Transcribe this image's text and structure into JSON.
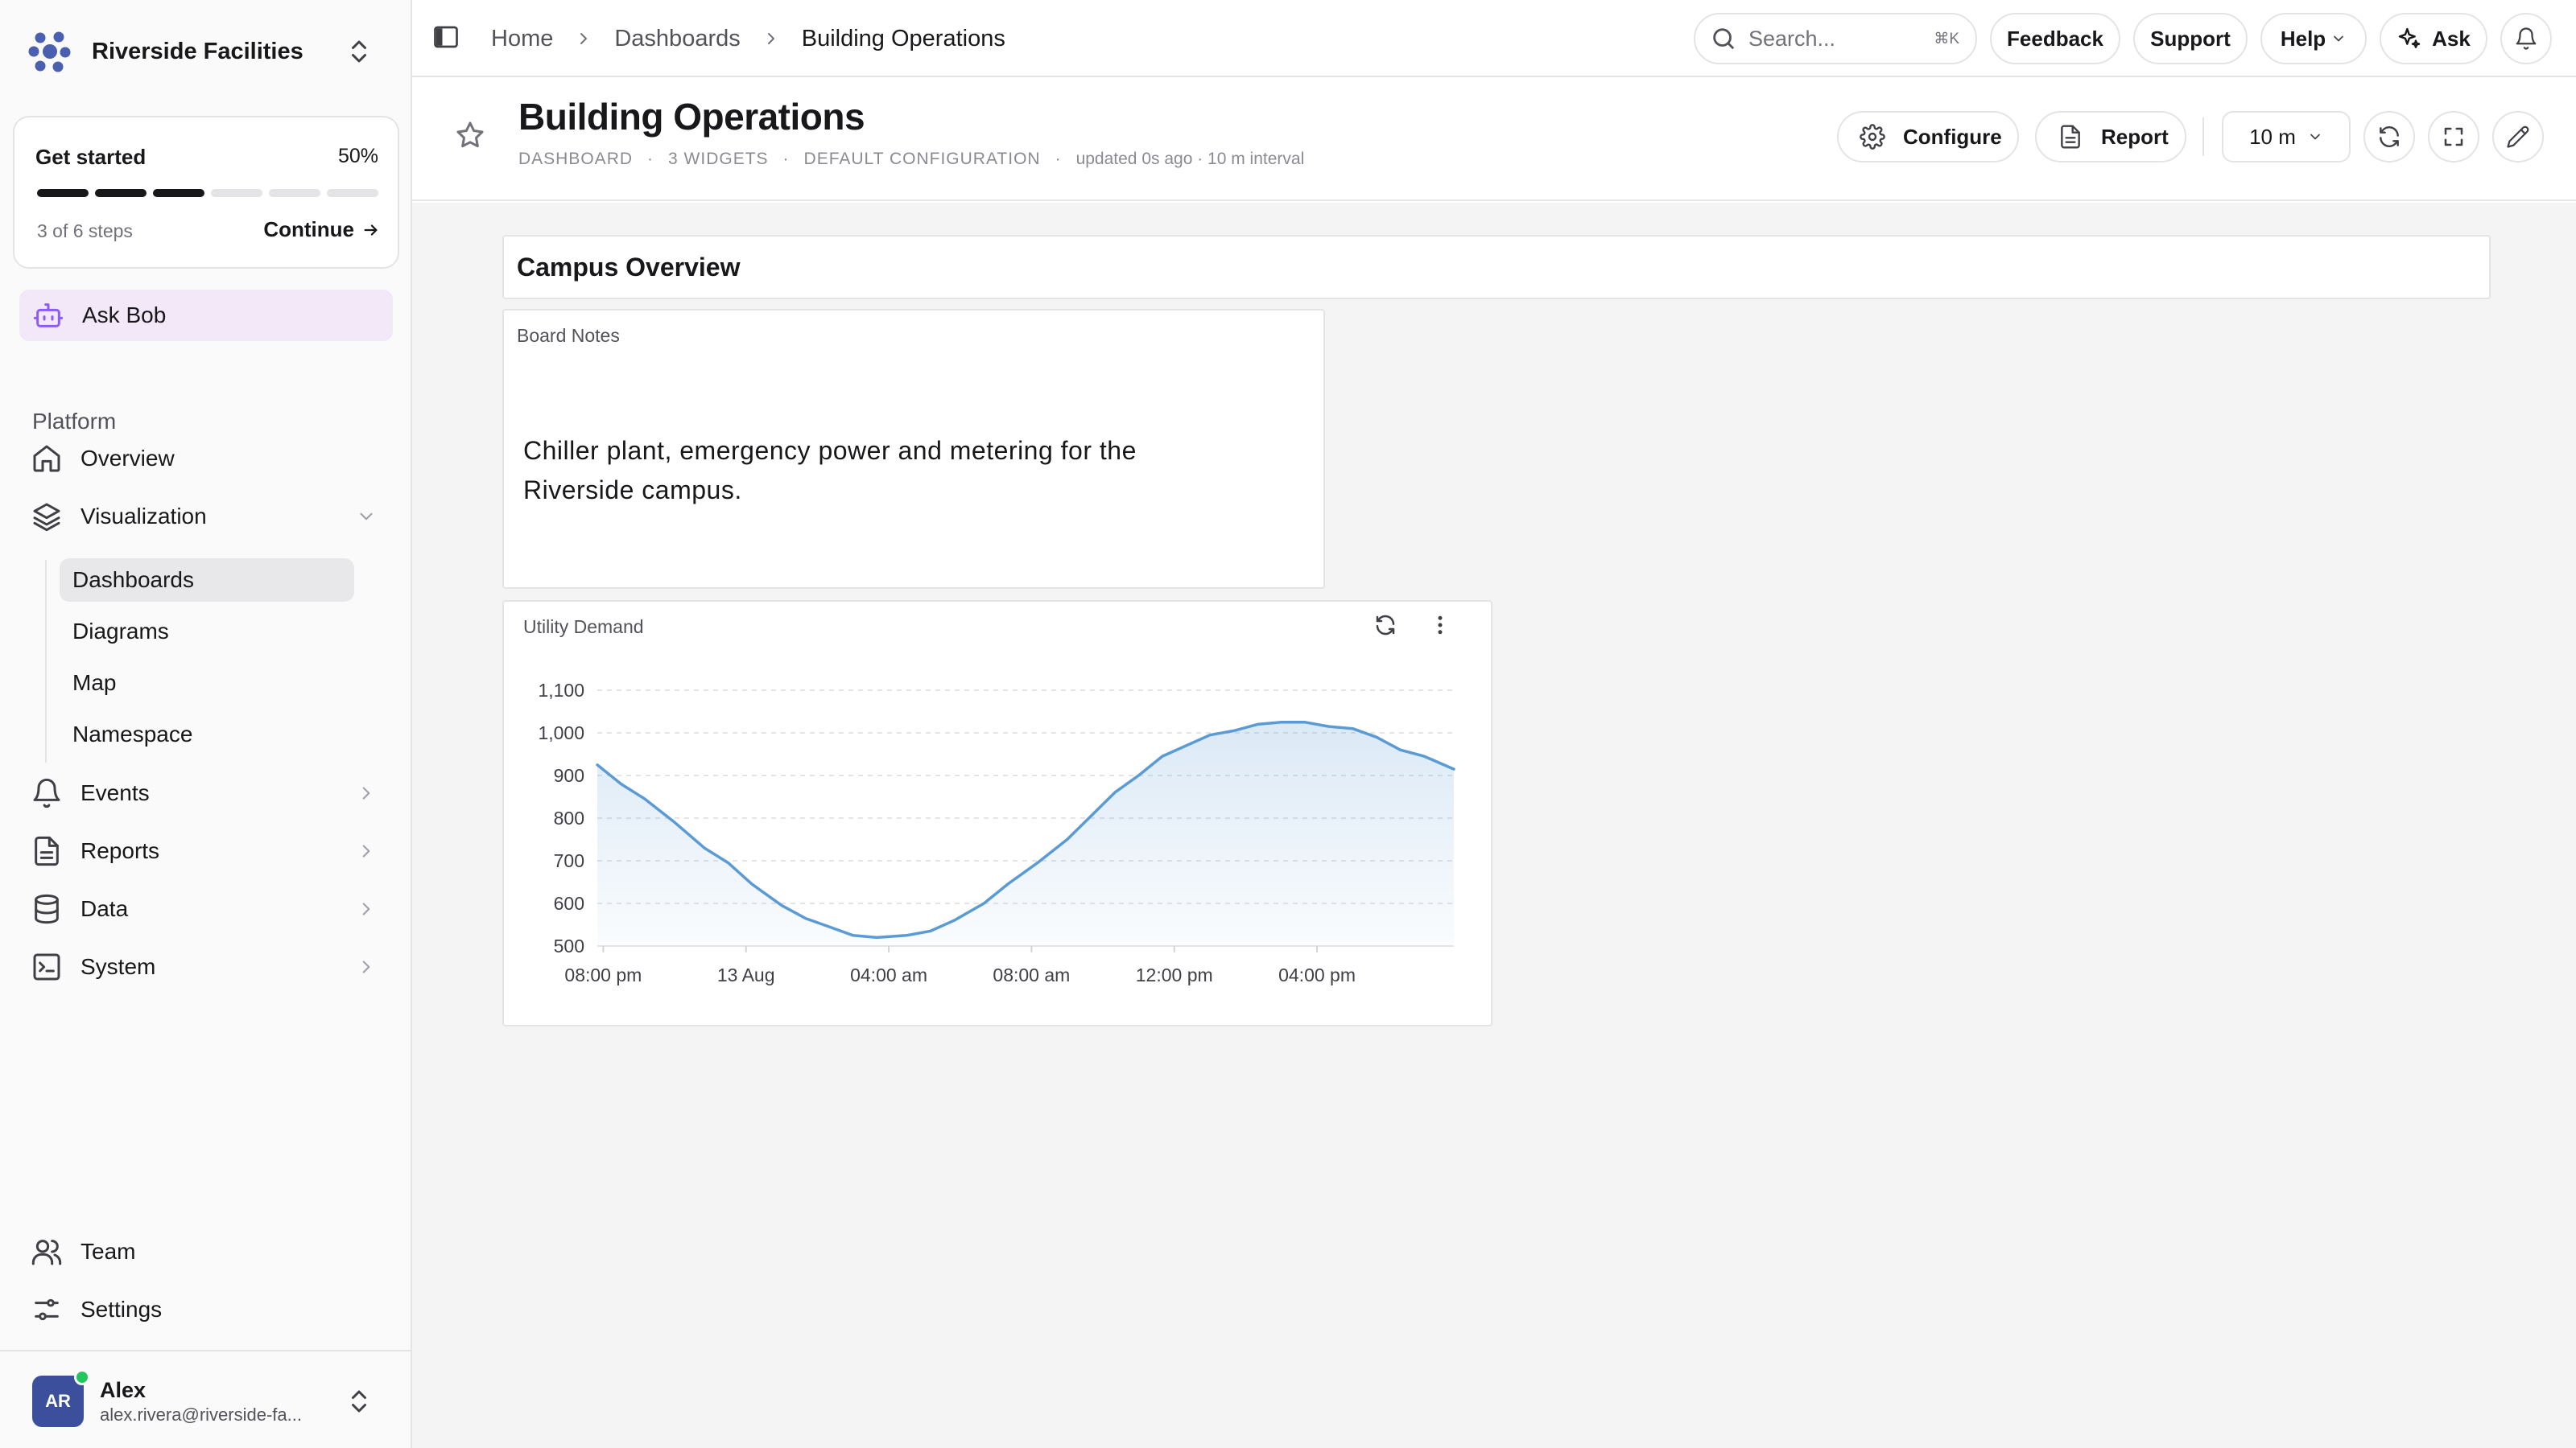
{
  "org": {
    "name": "Riverside Facilities"
  },
  "get_started": {
    "title": "Get started",
    "percent": "50%",
    "steps_text": "3 of 6 steps",
    "continue_label": "Continue",
    "completed_steps": 3,
    "total_steps": 6
  },
  "ask_bob": {
    "label": "Ask Bob"
  },
  "sidebar": {
    "group_label": "Platform",
    "items": [
      {
        "label": "Overview",
        "icon": "home-icon"
      },
      {
        "label": "Visualization",
        "icon": "layers-icon",
        "expanded": true
      },
      {
        "label": "Events",
        "icon": "bell-icon"
      },
      {
        "label": "Reports",
        "icon": "file-icon"
      },
      {
        "label": "Data",
        "icon": "database-icon"
      },
      {
        "label": "System",
        "icon": "terminal-icon"
      }
    ],
    "sub_items": [
      {
        "label": "Dashboards",
        "active": true
      },
      {
        "label": "Diagrams"
      },
      {
        "label": "Map"
      },
      {
        "label": "Namespace"
      }
    ],
    "bottom_items": [
      {
        "label": "Team",
        "icon": "users-icon"
      },
      {
        "label": "Settings",
        "icon": "sliders-icon"
      }
    ]
  },
  "user": {
    "initials": "AR",
    "name": "Alex",
    "email": "alex.rivera@riverside-fa...",
    "status_color": "#22c55e"
  },
  "topbar": {
    "breadcrumbs": [
      "Home",
      "Dashboards",
      "Building Operations"
    ],
    "search_placeholder": "Search...",
    "search_shortcut": "⌘K",
    "feedback_label": "Feedback",
    "support_label": "Support",
    "help_label": "Help",
    "ask_label": "Ask"
  },
  "page": {
    "title": "Building Operations",
    "meta": {
      "type": "DASHBOARD",
      "widgets": "3 WIDGETS",
      "config": "DEFAULT CONFIGURATION",
      "updated": "updated 0s ago · 10 m interval"
    },
    "configure_label": "Configure",
    "report_label": "Report",
    "interval_value": "10 m"
  },
  "section": {
    "title": "Campus Overview"
  },
  "notes_widget": {
    "title": "Board Notes",
    "body": "Chiller plant, emergency power and metering for the Riverside campus."
  },
  "chart_widget": {
    "title": "Utility Demand"
  },
  "chart_data": {
    "type": "area",
    "title": "",
    "xlabel": "",
    "ylabel": "",
    "ylim": [
      500,
      1100
    ],
    "y_ticks": [
      "500",
      "600",
      "700",
      "800",
      "900",
      "1,000",
      "1,100"
    ],
    "x_range": [
      "12 Aug 7:50 pm",
      "13 Aug 7:50 pm"
    ],
    "x_tick_labels": [
      "08:00 pm",
      "13 Aug",
      "04:00 am",
      "08:00 am",
      "12:00 pm",
      "04:00 pm"
    ],
    "grid": true,
    "line_color": "#5b9bd5",
    "series": [
      {
        "x": [
          "12 Aug 7:50 pm",
          "12 Aug 8:30 pm",
          "12 Aug 9:10 pm",
          "12 Aug 10:00 pm",
          "12 Aug 10:50 pm",
          "12 Aug 11:30 pm",
          "13 Aug 12:10 am",
          "13 Aug 1:00 am",
          "13 Aug 1:40 am",
          "13 Aug 2:20 am",
          "13 Aug 3:00 am",
          "13 Aug 3:40 am",
          "13 Aug 4:30 am",
          "13 Aug 5:10 am",
          "13 Aug 5:50 am",
          "13 Aug 6:40 am",
          "13 Aug 7:20 am",
          "13 Aug 8:10 am",
          "13 Aug 9:00 am",
          "13 Aug 9:40 am",
          "13 Aug 10:20 am",
          "13 Aug 11:00 am",
          "13 Aug 11:40 am",
          "13 Aug 12:20 pm",
          "13 Aug 1:00 pm",
          "13 Aug 1:40 pm",
          "13 Aug 2:20 pm",
          "13 Aug 3:00 pm",
          "13 Aug 3:40 pm",
          "13 Aug 4:20 pm",
          "13 Aug 5:00 pm",
          "13 Aug 5:40 pm",
          "13 Aug 6:20 pm",
          "13 Aug 7:00 pm",
          "13 Aug 7:50 pm"
        ],
        "values": [
          925,
          880,
          845,
          790,
          730,
          695,
          645,
          595,
          565,
          545,
          525,
          520,
          525,
          535,
          560,
          600,
          645,
          695,
          750,
          805,
          860,
          900,
          945,
          970,
          995,
          1005,
          1020,
          1025,
          1025,
          1015,
          1010,
          990,
          960,
          945,
          915
        ]
      }
    ]
  }
}
